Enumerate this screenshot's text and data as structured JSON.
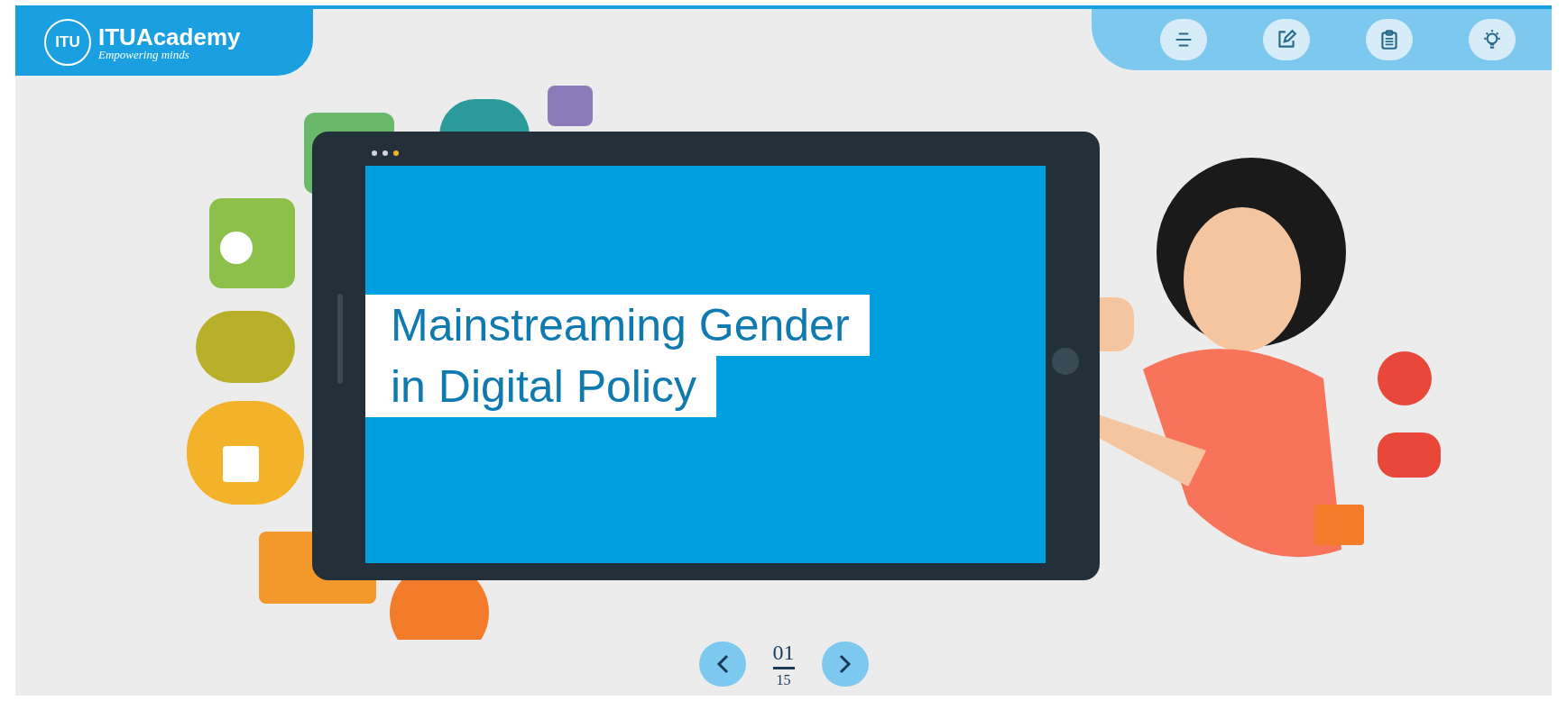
{
  "header": {
    "brand": "ITUAcademy",
    "logo_mark": "ITU",
    "tagline": "Empowering minds"
  },
  "toolbar": [
    {
      "kind": "menu"
    },
    {
      "kind": "notes"
    },
    {
      "kind": "clipboard"
    },
    {
      "kind": "tip"
    }
  ],
  "slide": {
    "title_lines": [
      "Mainstreaming Gender",
      "in Digital Policy"
    ]
  },
  "pagination": {
    "current": "01",
    "total": "15"
  }
}
